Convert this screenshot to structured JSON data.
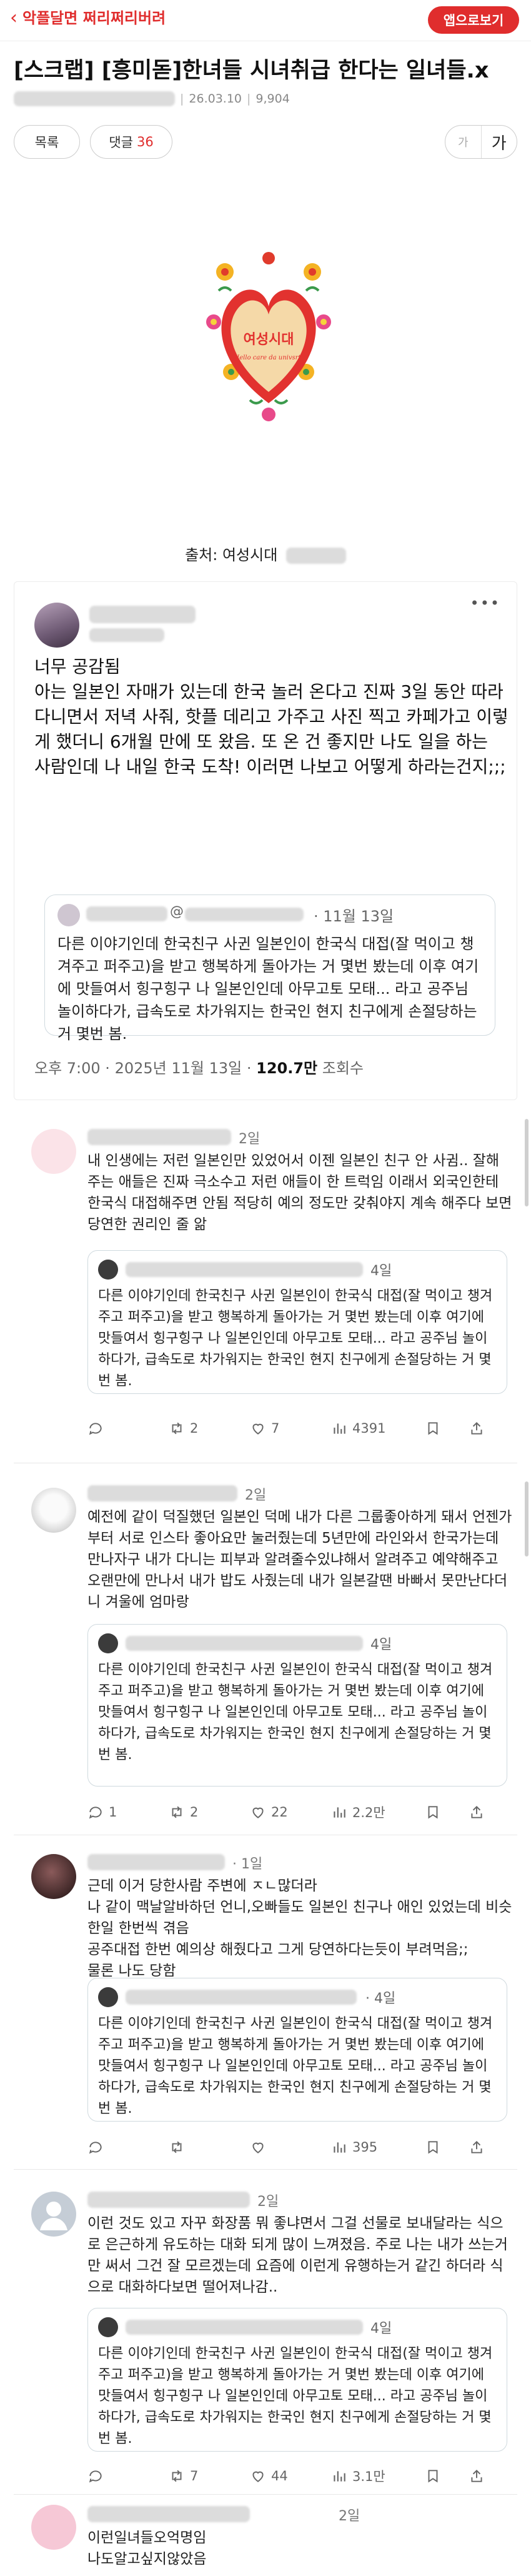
{
  "topbar": {
    "brand": "악플달면 쩌리쩌리버려",
    "app_button": "앱으로보기"
  },
  "post": {
    "title": "[스크랩] [흥미돋]한녀들 시녀취급 한다는 일녀들.x",
    "date": "26.03.10",
    "views": "9,904",
    "list_label": "목록",
    "comment_label": "댓글",
    "comment_count": "36",
    "font_small": "가",
    "font_large": "가"
  },
  "image": {
    "logo_text": "여성시대",
    "logo_sub": "Hello care da univsrt!"
  },
  "caption": "출처: 여성시대",
  "tweet": {
    "date": "11월 13일",
    "body": "너무 공감됨\n아는 일본인 자매가 있는데 한국 놀러 온다고 진짜 3일 동안 따라 다니면서 저녁 사줘, 핫플 데리고 가주고 사진 찍고 카페가고 이렇게 했더니 6개월 만에 또 왔음. 또 온 건 좋지만 나도 일을 하는 사람인데 나 내일 한국 도착! 이러면 나보고 어떻게 하라는건지;;;",
    "quote_handle": "@",
    "quote_date": "11월 13일",
    "quote_text": "다른 이야기인데 한국친구 사귄 일본인이 한국식 대접(잘 먹이고 챙겨주고 퍼주고)을 받고 행복하게 돌아가는 거 몇번 봤는데 이후 여기에 맛들여서 힝구힝구 나 일본인인데 아무고토 모태... 라고 공주님 놀이하다가, 급속도로 차가워지는 한국인 현지 친구에게 손절당하는 거 몇번 봄.",
    "footer_time": "오후 7:00 · 2025년 11월 13일 · ",
    "footer_views": "120.7만",
    "footer_views_label": " 조회수"
  },
  "replies": [
    {
      "age": "2일",
      "text": "내 인생에는 저런 일본인만 있었어서 이젠 일본인 친구 안 사귐.. 잘해주는 애들은 진짜 극소수고 저런 애들이 한 트럭임 이래서 외국인한테 한국식 대접해주면 안됨 적당히 예의 정도만 갖춰야지 계속 해주다 보면 당연한 권리인 줄 앎",
      "quote_date": "4일",
      "quote_text": "다른 이야기인데 한국친구 사귄 일본인이 한국식 대접(잘 먹이고 챙겨주고 퍼주고)을 받고 행복하게 돌아가는 거 몇번 봤는데 이후 여기에 맛들여서 힝구힝구 나 일본인인데 아무고토 모태... 라고 공주님 놀이하다가, 급속도로 차가워지는 한국인 현지 친구에게 손절당하는 거 몇번 봄.",
      "replies": "",
      "retweets": "2",
      "likes": "7",
      "views": "4391"
    },
    {
      "age": "2일",
      "text": "예전에 같이 덕질했던 일본인 덕메 내가 다른 그룹좋아하게 돼서 언젠가부터 서로 인스타 좋아요만 눌러줬는데 5년만에 라인와서 한국가는데 만나자구 내가 다니는 피부과 알려줄수있냐해서 알려주고 예약해주고 오랜만에 만나서 내가 밥도 사줬는데 내가 일본갈땐 바빠서 못만난다더니 겨울에 엄마랑",
      "quote_date": "4일",
      "quote_text": "다른 이야기인데 한국친구 사귄 일본인이 한국식 대접(잘 먹이고 챙겨주고 퍼주고)을 받고 행복하게 돌아가는 거 몇번 봤는데 이후 여기에 맛들여서 힝구힝구 나 일본인인데 아무고토 모태... 라고 공주님 놀이하다가, 급속도로 차가워지는 한국인 현지 친구에게 손절당하는 거 몇번 봄.",
      "replies": "1",
      "retweets": "2",
      "likes": "22",
      "views": "2.2만"
    },
    {
      "age": "· 1일",
      "handle_suffix": "ㅈㄴ많더라",
      "text": "근데 이거 당한사람 주변에 ㅈㄴ많더라\n나 같이 맥날알바하던 언니,오빠들도 일본인 친구나 애인 있었는데 비슷한일 한번씩 겪음\n공주대접 한번 예의상 해줬다고 그게 당연하다는듯이 부려먹음;;\n물론 나도 당함",
      "quote_date": "4일",
      "quote_text": "다른 이야기인데 한국친구 사귄 일본인이 한국식 대접(잘 먹이고 챙겨주고 퍼주고)을 받고 행복하게 돌아가는 거 몇번 봤는데 이후 여기에 맛들여서 힝구힝구 나 일본인인데 아무고토 모태... 라고 공주님 놀이하다가, 급속도로 차가워지는 한국인 현지 친구에게 손절당하는 거 몇번 봄.",
      "replies": "",
      "retweets": "",
      "likes": "",
      "views": "395"
    },
    {
      "age": "2일",
      "text": "이런 것도 있고 자꾸 화장품 뭐 좋냐면서 그걸 선물로 보내달라는 식으로 은근하게 유도하는 대화 되게 많이 느껴졌음. 주로 나는 내가 쓰는거만 써서 그건 잘 모르겠는데 요즘에 이런게 유행하는거 같긴 하더라 식으로 대화하다보면 떨어져나감..",
      "quote_date": "4일",
      "quote_text": "다른 이야기인데 한국친구 사귄 일본인이 한국식 대접(잘 먹이고 챙겨주고 퍼주고)을 받고 행복하게 돌아가는 거 몇번 봤는데 이후 여기에 맛들여서 힝구힝구 나 일본인인데 아무고토 모태... 라고 공주님 놀이하다가, 급속도로 차가워지는 한국인 현지 친구에게 손절당하는 거 몇번 봄.",
      "replies": "",
      "retweets": "7",
      "likes": "44",
      "views": "3.1만"
    },
    {
      "age": "2일",
      "text": "이런일녀들오억명임\n나도알고싶지않았음"
    }
  ]
}
